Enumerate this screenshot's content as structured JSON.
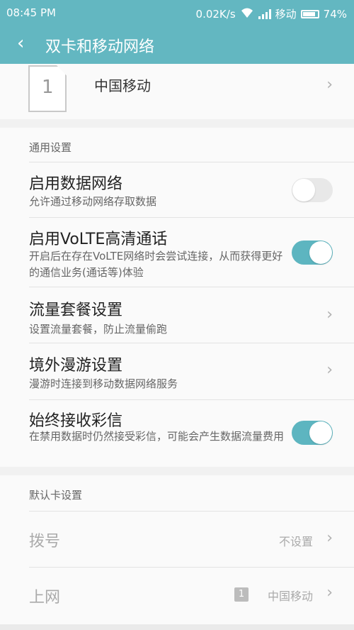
{
  "status_bar": {
    "time": "08:45 PM",
    "speed": "0.02K/s",
    "carrier": "移动",
    "battery": "74%",
    "wifi_icon": "wifi-icon",
    "signal_icon": "signal-icon"
  },
  "header": {
    "back_icon": "‹",
    "title": "双卡和移动网络"
  },
  "sim": {
    "slot": "1",
    "name": "中国移动"
  },
  "general": {
    "header": "通用设置",
    "items": [
      {
        "title": "启用数据网络",
        "subtitle": "允许通过移动网络存取数据",
        "toggle": false
      },
      {
        "title": "启用VoLTE高清通话",
        "subtitle": "开启后在存在VoLTE网络时会尝试连接，从而获得更好的通信业务(通话等)体验",
        "toggle": true
      },
      {
        "title": "流量套餐设置",
        "subtitle": "设置流量套餐，防止流量偷跑"
      },
      {
        "title": "境外漫游设置",
        "subtitle": "漫游时连接到移动数据网络服务"
      },
      {
        "title": "始终接收彩信",
        "subtitle": "在禁用数据时仍然接受彩信，可能会产生数据流量费用",
        "toggle": true
      }
    ]
  },
  "default_card": {
    "header": "默认卡设置",
    "dial_label": "拨号",
    "dial_value": "不设置",
    "internet_label": "上网",
    "internet_badge": "1",
    "internet_value": "中国移动"
  },
  "colors": {
    "accent": "#63b7c1",
    "toggle_on": "#5db5c0"
  }
}
